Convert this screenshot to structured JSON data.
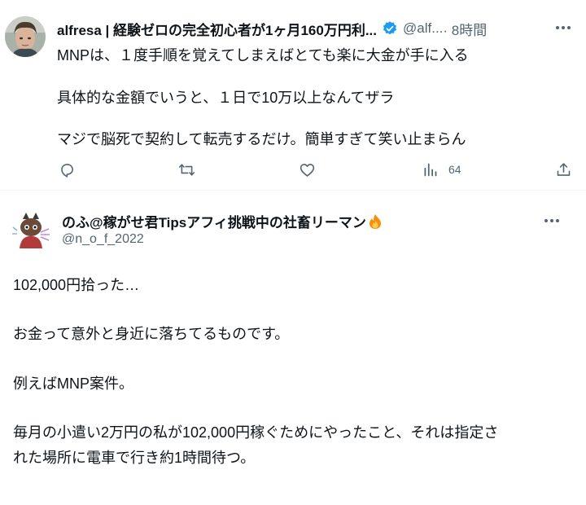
{
  "tweet1": {
    "author_name": "alfresa | 経験ゼロの完全初心者が1ヶ月160万円利...",
    "handle": "@alf...",
    "time": "· 8時間",
    "lines": [
      "MNPは、１度手順を覚えてしまえばとても楽に大金が手に入る",
      "具体的な金額でいうと、１日で10万以上なんてザラ",
      "マジで脳死で契約して転売するだけ。簡単すぎて笑い止まらん"
    ],
    "actions": {
      "reply_icon": "reply-icon",
      "retweet_icon": "retweet-icon",
      "like_icon": "like-icon",
      "views_icon": "views-icon",
      "views_count": "64",
      "share_icon": "share-icon"
    },
    "verified_color": "#1d9bf0"
  },
  "tweet2": {
    "author_name": "のふ@稼がせ君Tipsアフィ挑戦中の社畜リーマン",
    "handle": "@n_o_f_2022",
    "lines": [
      "102,000円拾った…",
      "お金って意外と身近に落ちてるものです。",
      "例えばMNP案件。",
      "毎月の小遣い2万円の私が102,000円稼ぐためにやったこと、それは指定さ",
      "れた場所に電車で行き約1時間待つ。"
    ]
  },
  "colors": {
    "text": "#0f1419",
    "secondary": "#536471",
    "divider": "#eff3f4"
  }
}
